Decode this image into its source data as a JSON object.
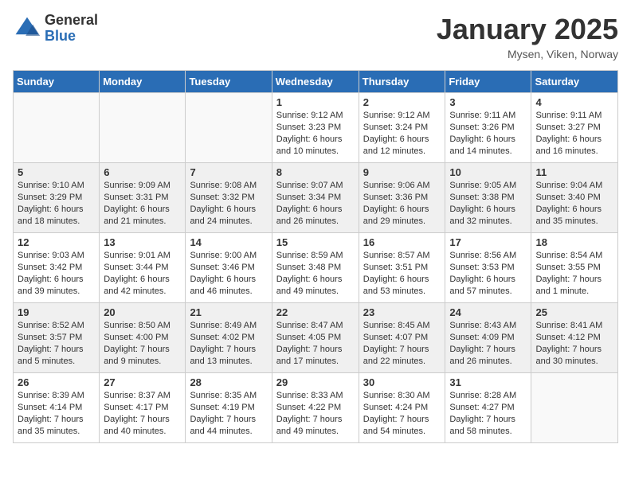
{
  "header": {
    "logo_general": "General",
    "logo_blue": "Blue",
    "title": "January 2025",
    "subtitle": "Mysen, Viken, Norway"
  },
  "weekdays": [
    "Sunday",
    "Monday",
    "Tuesday",
    "Wednesday",
    "Thursday",
    "Friday",
    "Saturday"
  ],
  "weeks": [
    [
      {
        "day": "",
        "sunrise": "",
        "sunset": "",
        "daylight": ""
      },
      {
        "day": "",
        "sunrise": "",
        "sunset": "",
        "daylight": ""
      },
      {
        "day": "",
        "sunrise": "",
        "sunset": "",
        "daylight": ""
      },
      {
        "day": "1",
        "sunrise": "Sunrise: 9:12 AM",
        "sunset": "Sunset: 3:23 PM",
        "daylight": "Daylight: 6 hours and 10 minutes."
      },
      {
        "day": "2",
        "sunrise": "Sunrise: 9:12 AM",
        "sunset": "Sunset: 3:24 PM",
        "daylight": "Daylight: 6 hours and 12 minutes."
      },
      {
        "day": "3",
        "sunrise": "Sunrise: 9:11 AM",
        "sunset": "Sunset: 3:26 PM",
        "daylight": "Daylight: 6 hours and 14 minutes."
      },
      {
        "day": "4",
        "sunrise": "Sunrise: 9:11 AM",
        "sunset": "Sunset: 3:27 PM",
        "daylight": "Daylight: 6 hours and 16 minutes."
      }
    ],
    [
      {
        "day": "5",
        "sunrise": "Sunrise: 9:10 AM",
        "sunset": "Sunset: 3:29 PM",
        "daylight": "Daylight: 6 hours and 18 minutes."
      },
      {
        "day": "6",
        "sunrise": "Sunrise: 9:09 AM",
        "sunset": "Sunset: 3:31 PM",
        "daylight": "Daylight: 6 hours and 21 minutes."
      },
      {
        "day": "7",
        "sunrise": "Sunrise: 9:08 AM",
        "sunset": "Sunset: 3:32 PM",
        "daylight": "Daylight: 6 hours and 24 minutes."
      },
      {
        "day": "8",
        "sunrise": "Sunrise: 9:07 AM",
        "sunset": "Sunset: 3:34 PM",
        "daylight": "Daylight: 6 hours and 26 minutes."
      },
      {
        "day": "9",
        "sunrise": "Sunrise: 9:06 AM",
        "sunset": "Sunset: 3:36 PM",
        "daylight": "Daylight: 6 hours and 29 minutes."
      },
      {
        "day": "10",
        "sunrise": "Sunrise: 9:05 AM",
        "sunset": "Sunset: 3:38 PM",
        "daylight": "Daylight: 6 hours and 32 minutes."
      },
      {
        "day": "11",
        "sunrise": "Sunrise: 9:04 AM",
        "sunset": "Sunset: 3:40 PM",
        "daylight": "Daylight: 6 hours and 35 minutes."
      }
    ],
    [
      {
        "day": "12",
        "sunrise": "Sunrise: 9:03 AM",
        "sunset": "Sunset: 3:42 PM",
        "daylight": "Daylight: 6 hours and 39 minutes."
      },
      {
        "day": "13",
        "sunrise": "Sunrise: 9:01 AM",
        "sunset": "Sunset: 3:44 PM",
        "daylight": "Daylight: 6 hours and 42 minutes."
      },
      {
        "day": "14",
        "sunrise": "Sunrise: 9:00 AM",
        "sunset": "Sunset: 3:46 PM",
        "daylight": "Daylight: 6 hours and 46 minutes."
      },
      {
        "day": "15",
        "sunrise": "Sunrise: 8:59 AM",
        "sunset": "Sunset: 3:48 PM",
        "daylight": "Daylight: 6 hours and 49 minutes."
      },
      {
        "day": "16",
        "sunrise": "Sunrise: 8:57 AM",
        "sunset": "Sunset: 3:51 PM",
        "daylight": "Daylight: 6 hours and 53 minutes."
      },
      {
        "day": "17",
        "sunrise": "Sunrise: 8:56 AM",
        "sunset": "Sunset: 3:53 PM",
        "daylight": "Daylight: 6 hours and 57 minutes."
      },
      {
        "day": "18",
        "sunrise": "Sunrise: 8:54 AM",
        "sunset": "Sunset: 3:55 PM",
        "daylight": "Daylight: 7 hours and 1 minute."
      }
    ],
    [
      {
        "day": "19",
        "sunrise": "Sunrise: 8:52 AM",
        "sunset": "Sunset: 3:57 PM",
        "daylight": "Daylight: 7 hours and 5 minutes."
      },
      {
        "day": "20",
        "sunrise": "Sunrise: 8:50 AM",
        "sunset": "Sunset: 4:00 PM",
        "daylight": "Daylight: 7 hours and 9 minutes."
      },
      {
        "day": "21",
        "sunrise": "Sunrise: 8:49 AM",
        "sunset": "Sunset: 4:02 PM",
        "daylight": "Daylight: 7 hours and 13 minutes."
      },
      {
        "day": "22",
        "sunrise": "Sunrise: 8:47 AM",
        "sunset": "Sunset: 4:05 PM",
        "daylight": "Daylight: 7 hours and 17 minutes."
      },
      {
        "day": "23",
        "sunrise": "Sunrise: 8:45 AM",
        "sunset": "Sunset: 4:07 PM",
        "daylight": "Daylight: 7 hours and 22 minutes."
      },
      {
        "day": "24",
        "sunrise": "Sunrise: 8:43 AM",
        "sunset": "Sunset: 4:09 PM",
        "daylight": "Daylight: 7 hours and 26 minutes."
      },
      {
        "day": "25",
        "sunrise": "Sunrise: 8:41 AM",
        "sunset": "Sunset: 4:12 PM",
        "daylight": "Daylight: 7 hours and 30 minutes."
      }
    ],
    [
      {
        "day": "26",
        "sunrise": "Sunrise: 8:39 AM",
        "sunset": "Sunset: 4:14 PM",
        "daylight": "Daylight: 7 hours and 35 minutes."
      },
      {
        "day": "27",
        "sunrise": "Sunrise: 8:37 AM",
        "sunset": "Sunset: 4:17 PM",
        "daylight": "Daylight: 7 hours and 40 minutes."
      },
      {
        "day": "28",
        "sunrise": "Sunrise: 8:35 AM",
        "sunset": "Sunset: 4:19 PM",
        "daylight": "Daylight: 7 hours and 44 minutes."
      },
      {
        "day": "29",
        "sunrise": "Sunrise: 8:33 AM",
        "sunset": "Sunset: 4:22 PM",
        "daylight": "Daylight: 7 hours and 49 minutes."
      },
      {
        "day": "30",
        "sunrise": "Sunrise: 8:30 AM",
        "sunset": "Sunset: 4:24 PM",
        "daylight": "Daylight: 7 hours and 54 minutes."
      },
      {
        "day": "31",
        "sunrise": "Sunrise: 8:28 AM",
        "sunset": "Sunset: 4:27 PM",
        "daylight": "Daylight: 7 hours and 58 minutes."
      },
      {
        "day": "",
        "sunrise": "",
        "sunset": "",
        "daylight": ""
      }
    ]
  ]
}
